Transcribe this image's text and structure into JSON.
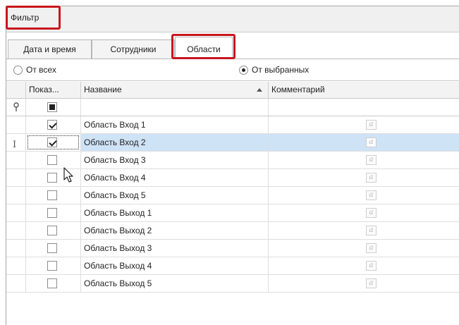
{
  "filter": {
    "title": "Фильтр"
  },
  "tabs": [
    {
      "label": "Дата и время",
      "active": false
    },
    {
      "label": "Сотрудники",
      "active": false
    },
    {
      "label": "Области",
      "active": true
    }
  ],
  "radio": {
    "options": [
      {
        "label": "От всех",
        "selected": false
      },
      {
        "label": "От выбранных",
        "selected": true
      }
    ]
  },
  "grid": {
    "columns": [
      "Показ...",
      "Название",
      "Комментарий"
    ],
    "sort_column": "Название",
    "rows": [
      {
        "name": "Область Вход 1",
        "checked": true,
        "selected": false
      },
      {
        "name": "Область Вход 2",
        "checked": true,
        "selected": true
      },
      {
        "name": "Область Вход 3",
        "checked": false,
        "selected": false
      },
      {
        "name": "Область Вход 4",
        "checked": false,
        "selected": false
      },
      {
        "name": "Область Вход 5",
        "checked": false,
        "selected": false
      },
      {
        "name": "Область Выход 1",
        "checked": false,
        "selected": false
      },
      {
        "name": "Область Выход 2",
        "checked": false,
        "selected": false
      },
      {
        "name": "Область Выход 3",
        "checked": false,
        "selected": false
      },
      {
        "name": "Область Выход 4",
        "checked": false,
        "selected": false
      },
      {
        "name": "Область Выход 5",
        "checked": false,
        "selected": false
      }
    ],
    "comment_icon_glyph": "a"
  },
  "colors": {
    "highlight": "#c8161d",
    "selection": "#cfe3f6"
  }
}
